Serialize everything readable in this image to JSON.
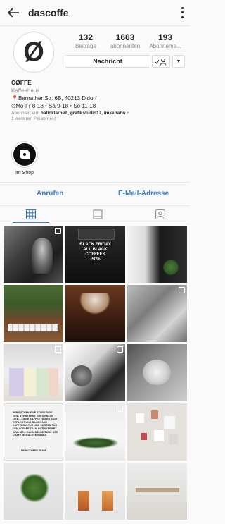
{
  "header": {
    "username": "dascoffe"
  },
  "stats": [
    {
      "number": "132",
      "label": "Beiträge"
    },
    {
      "number": "1663",
      "label": "abonnenten"
    },
    {
      "number": "193",
      "label": "Abonneme..."
    }
  ],
  "avatar": {
    "logo_text": "Ø"
  },
  "actions": {
    "message_label": "Nachricht"
  },
  "bio": {
    "name": "CØFFE",
    "category": "Kaffeehaus",
    "address": "Benrather Str. 6B, 40213 D'dorf",
    "hours": "Mo-Fr 8-18 • Sa 9-18 • So 11-18",
    "followed_prefix": "Abonniert von ",
    "followed_names": "halloklarheit, grafikstudio17, imkehahn",
    "followed_suffix": " +",
    "followed_more": "1 weiteren Person(en)"
  },
  "highlight": {
    "label": "Im Shop"
  },
  "contact": {
    "call": "Anrufen",
    "email": "E-Mail-Adresse"
  },
  "posts": {
    "black_friday_lines": [
      "BLACK FRIDAY",
      "ALL BLACK",
      "COFFEES",
      "-50%"
    ],
    "notice_text": "WIR SUCHEN EINE STARKENDE TEIL- VERSTÄRKT. DIE DIENSTE LIEB... LIEBE KAFFEE HABEN SICH GEPLEGT UND BILDUNG IN KAFFEEKULTUR UND SORTEN FÜR DEN COFFEE TEAM INTERESSIERT SIND SIE... DANN MELDE DICH! DER CRAFT MEGALOVE BAALS",
    "notice_sign": "DEIN COFFEE TEAM"
  },
  "colors": {
    "accent": "#3f80c4",
    "text": "#262626",
    "muted": "#8e8e8e",
    "border": "#dbdbdb"
  }
}
